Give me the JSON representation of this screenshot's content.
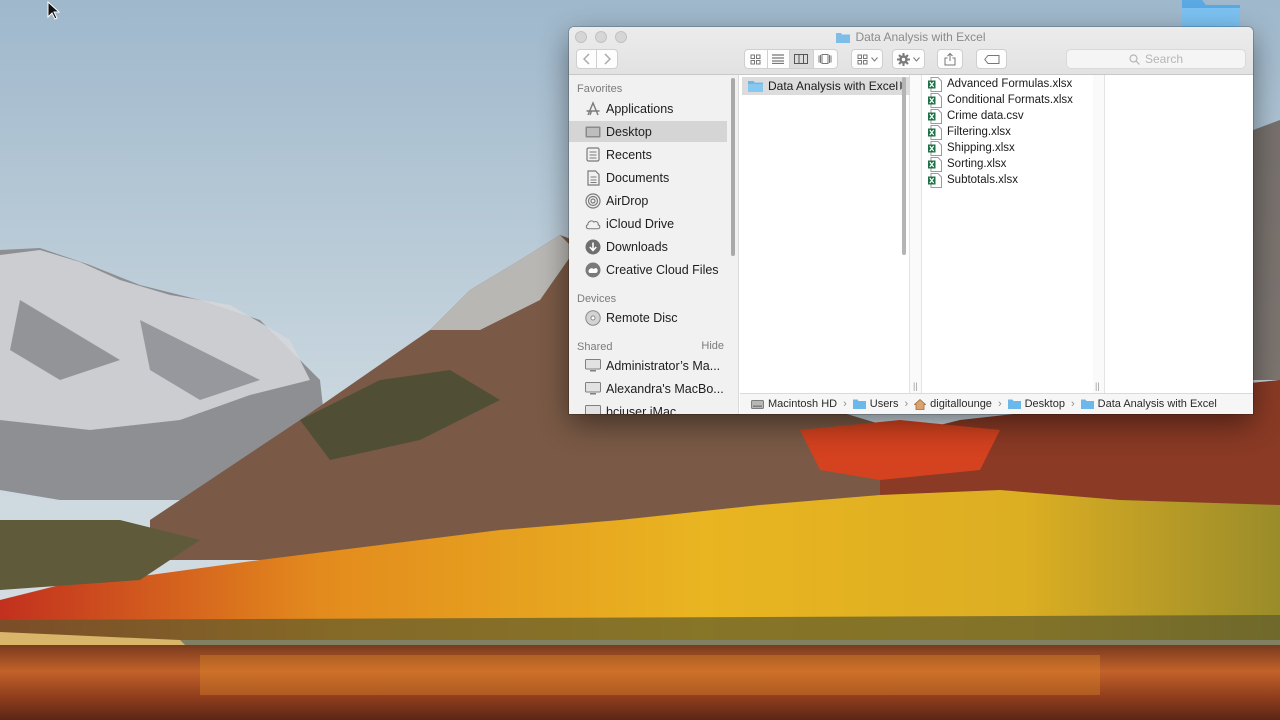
{
  "window": {
    "title": "Data Analysis with Excel",
    "search_placeholder": "Search"
  },
  "sidebar": {
    "favorites_header": "Favorites",
    "favorites": [
      {
        "label": "Applications",
        "icon": "applications-icon"
      },
      {
        "label": "Desktop",
        "icon": "desktop-icon",
        "selected": true
      },
      {
        "label": "Recents",
        "icon": "recents-icon"
      },
      {
        "label": "Documents",
        "icon": "documents-icon"
      },
      {
        "label": "AirDrop",
        "icon": "airdrop-icon"
      },
      {
        "label": "iCloud Drive",
        "icon": "icloud-icon"
      },
      {
        "label": "Downloads",
        "icon": "downloads-icon"
      },
      {
        "label": "Creative Cloud Files",
        "icon": "creative-cloud-icon"
      }
    ],
    "devices_header": "Devices",
    "devices": [
      {
        "label": "Remote Disc",
        "icon": "remote-disc-icon"
      }
    ],
    "shared_header": "Shared",
    "shared_hide": "Hide",
    "shared": [
      {
        "label": "Administrator’s Ma...",
        "icon": "computer-icon"
      },
      {
        "label": "Alexandra's MacBo...",
        "icon": "computer-icon"
      },
      {
        "label": "bciuser iMac",
        "icon": "computer-icon"
      }
    ]
  },
  "columns": {
    "first": [
      {
        "label": "Data Analysis with Excel",
        "selected": true
      }
    ],
    "files": [
      "Advanced Formulas.xlsx",
      "Conditional Formats.xlsx",
      "Crime data.csv",
      "Filtering.xlsx",
      "Shipping.xlsx",
      "Sorting.xlsx",
      "Subtotals.xlsx"
    ]
  },
  "pathbar": [
    {
      "label": "Macintosh HD",
      "icon": "hard-drive-icon"
    },
    {
      "label": "Users",
      "icon": "folder-icon"
    },
    {
      "label": "digitallounge",
      "icon": "home-icon"
    },
    {
      "label": "Desktop",
      "icon": "folder-icon"
    },
    {
      "label": "Data Analysis with Excel",
      "icon": "folder-icon"
    }
  ],
  "colors": {
    "folder_blue": "#6cb8ea",
    "excel_green": "#1e7145",
    "selection_gray": "#d5d5d5"
  }
}
